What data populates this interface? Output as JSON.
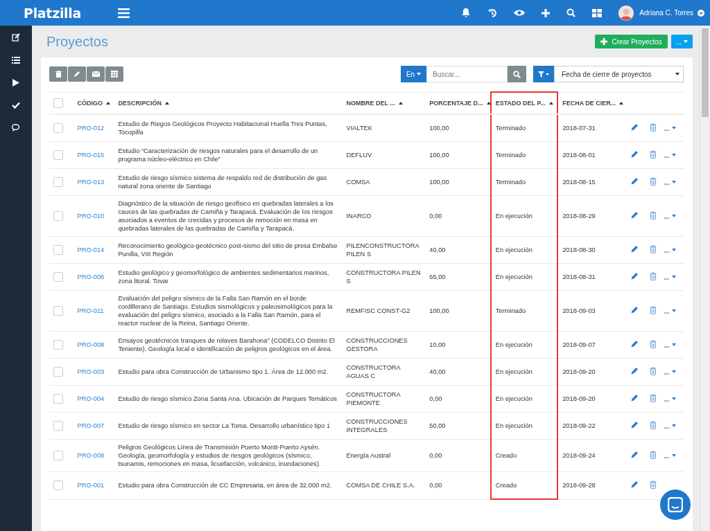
{
  "app": {
    "logo": "Platzilla",
    "user": "Adriana C. Torres"
  },
  "page": {
    "title": "Proyectos",
    "create_button": "Crear Proyectos",
    "more_button": "..."
  },
  "toolbar": {
    "language": "En",
    "search": {
      "placeholder": "Buscar..."
    },
    "filter": {
      "value": "Fecha de cierre de proyectos"
    }
  },
  "table": {
    "select_all_checked": false,
    "columns": [
      {
        "label": "CÓDIGO",
        "highlighted": false
      },
      {
        "label": "DESCRIPCIÓN",
        "highlighted": false
      },
      {
        "label": "NOMBRE DEL ...",
        "highlighted": false
      },
      {
        "label": "PORCENTAJE D...",
        "highlighted": false
      },
      {
        "label": "ESTADO DEL P...",
        "highlighted": true
      },
      {
        "label": "FECHA DE CIER...",
        "highlighted": false
      }
    ],
    "rows": [
      {
        "code": "PRO-012",
        "description": "Estudio de Riegos Geológicos Proyecto Habitacional Huella Tres Puntas, Tocopilla",
        "client": "VIALTEK",
        "percent": "100,00",
        "status": "Terminado",
        "date": "2018-07-31",
        "menu": "...",
        "checked": false
      },
      {
        "code": "PRO-015",
        "description": "Estudio “Caracterización de riesgos naturales para el desarrollo de un programa núcleo-eléctrico en Chile”",
        "client": "DEFLUV",
        "percent": "100,00",
        "status": "Terminado",
        "date": "2018-08-01",
        "menu": "...",
        "checked": false
      },
      {
        "code": "PRO-013",
        "description": "Estudio de riesgo sísmico sistema de respaldo red de distribución de gas natural zona oriente de Santiago",
        "client": "COMSA",
        "percent": "100,00",
        "status": "Terminado",
        "date": "2018-08-15",
        "menu": "...",
        "checked": false
      },
      {
        "code": "PRO-010",
        "description": "Diagnóstico de la situación de riesgo geofísico en quebradas laterales a los cauces de las quebradas de Camiña y Tarapacá. Evaluación de los riesgos asociados a eventos de crecidas y procesos de remoción en masa en quebradas laterales de las quebradas de Camiña y Tarapacá.",
        "client": "INARCO",
        "percent": "0,00",
        "status": "En ejecución",
        "date": "2018-08-29",
        "menu": "...",
        "checked": false
      },
      {
        "code": "PRO-014",
        "description": "Reconocimiento geológico-geotécnico post-sismo del sitio de presa Embalse Punilla, VIII Región",
        "client": "PILENCONSTRUCTORA PILEN S",
        "percent": "40,00",
        "status": "En ejecución",
        "date": "2018-08-30",
        "menu": "...",
        "checked": false
      },
      {
        "code": "PRO-006",
        "description": "Estudio geológico y geomorfológico de ambientes sedimentarios marinos, zona litoral. Tovar",
        "client": "CONSTRUCTORA PILEN S",
        "percent": "65,00",
        "status": "En ejecución",
        "date": "2018-08-31",
        "menu": "...",
        "checked": false
      },
      {
        "code": "PRO-011",
        "description": "Evaluación del peligro sísmico de la Falla San Ramón en el borde cordillerano de Santiago. Estudios sismológicos y paleosimológicos para la evaluación del peligro sísmico, asociado a la Falla San Ramón, para el reactor nuclear de la Reina, Santiago Oriente.",
        "client": "REMFISC CONST-G2",
        "percent": "100,00",
        "status": "Terminado",
        "date": "2018-09-03",
        "menu": "...",
        "checked": false
      },
      {
        "code": "PRO-008",
        "description": "Ensayos geotécnicos tranques de relaves Barahona\" (CODELCO Distrito El Teniente). Geología local e identificación de peligros geológicos en el área.",
        "client": "CONSTRUCCIONES GESTORA",
        "percent": "10,00",
        "status": "En ejecución",
        "date": "2018-09-07",
        "menu": "...",
        "checked": false
      },
      {
        "code": "PRO-003",
        "description": "Estudio para obra Construcción de Urbanismo tipo 1. Área de 12.000 m2.",
        "client": "CONSTRUCTORA AGUAS C",
        "percent": "40,00",
        "status": "En ejecución",
        "date": "2018-09-20",
        "menu": "...",
        "checked": false
      },
      {
        "code": "PRO-004",
        "description": "Estudio de riesgo sísmico Zona Santa Ana. Ubicación de Parques Temáticos",
        "client": "CONSTRUCTORA PIEMONTE",
        "percent": "0,00",
        "status": "En ejecución",
        "date": "2018-09-20",
        "menu": "...",
        "checked": false
      },
      {
        "code": "PRO-007",
        "description": "Estudio de riesgo sísmico en sector La Toma. Desarrollo urbanístico tipo 1",
        "client": "CONSTRUCCIONES INTEGRALES",
        "percent": "50,00",
        "status": "En ejecución",
        "date": "2018-09-22",
        "menu": "...",
        "checked": false
      },
      {
        "code": "PRO-009",
        "description": "Peligros Geológicos Línea de Transmisión Puerto Montt-Puerto Aysén. Geología, geomorfología y estudios de riesgos geológicos (sísmico, tsunamis, remociones en masa, licuefacción, volcánico, inundaciones).",
        "client": "Energía Austral",
        "percent": "0,00",
        "status": "Creado",
        "date": "2018-09-24",
        "menu": "...",
        "checked": false
      },
      {
        "code": "PRO-001",
        "description": "Estudio para obra Construcción de CC Empresaria, en área de 32.000 m2.",
        "client": "COMSA DE CHILE S.A.",
        "percent": "0,00",
        "status": "Creado",
        "date": "2018-09-28",
        "checked": false
      }
    ]
  }
}
